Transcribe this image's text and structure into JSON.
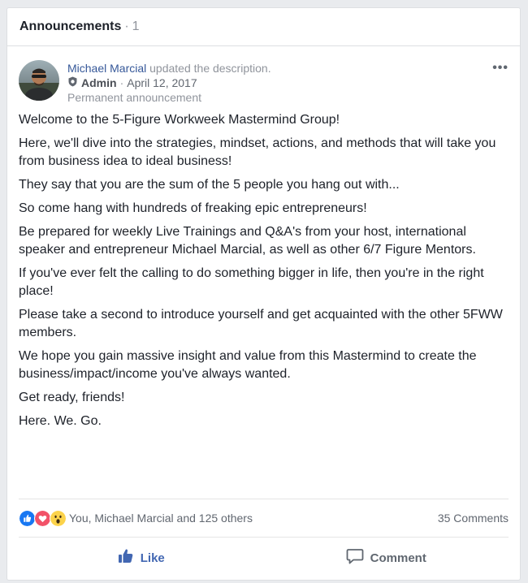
{
  "header": {
    "title": "Announcements",
    "separator": "·",
    "count": "1"
  },
  "post": {
    "author": "Michael Marcial",
    "action": "updated the description.",
    "role": "Admin",
    "role_separator": "·",
    "date": "April 12, 2017",
    "pinned_label": "Permanent announcement",
    "more_label": "•••",
    "paragraphs": [
      "Welcome to the 5-Figure Workweek Mastermind Group!",
      "Here, we'll dive into the strategies, mindset, actions, and methods that will take you from business idea to ideal business!",
      "They say that you are the sum of the 5 people you hang out with...",
      "So come hang with hundreds of freaking epic entrepreneurs!",
      "Be prepared for weekly Live Trainings and Q&A's from your host, international speaker and entrepreneur Michael Marcial, as well as other 6/7 Figure Mentors.",
      "If you've ever felt the calling to do something bigger in life, then you're in the right place!",
      "Please take a second to introduce yourself and get acquainted with the other 5FWW members.",
      "We hope you gain massive insight and value from this Mastermind to create the business/impact/income you've always wanted.",
      "Get ready, friends!",
      "Here. We. Go."
    ]
  },
  "stats": {
    "reaction_icons": [
      "like-icon",
      "love-icon",
      "wow-icon"
    ],
    "reactions_text": "You, Michael Marcial and 125 others",
    "comments_text": "35 Comments"
  },
  "actions": {
    "like_label": "Like",
    "comment_label": "Comment"
  },
  "colors": {
    "link_blue": "#365899",
    "like_blue": "#4267b2",
    "love_red": "#f25268",
    "wow_yellow": "#fcd34b",
    "muted_gray": "#90949c"
  }
}
